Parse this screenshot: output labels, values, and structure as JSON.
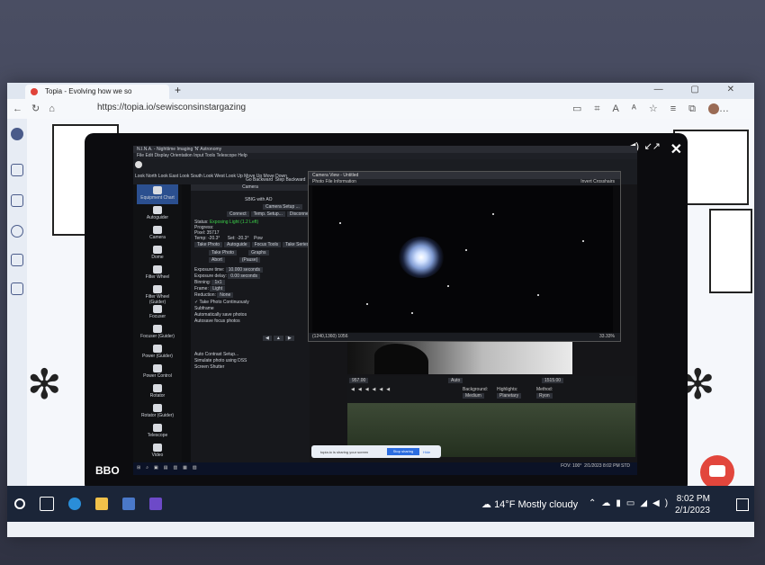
{
  "browser": {
    "tab_title": "Topia - Evolving how we so",
    "new_tab": "+",
    "window_controls": "— ▢ ✕",
    "url": "https://topia.io/sewisconsinstargazing"
  },
  "overlay": {
    "brand": "BBO"
  },
  "app": {
    "title": "N.I.N.A. - Nighttime Imaging 'N' Astronomy",
    "menu": "File  Edit  Display  Orientation  Input  Tools  Telescope  Help",
    "toolbar": [
      "Look North",
      "Look East",
      "Look South",
      "Look West",
      "Look Up",
      "Move Up",
      "Move Down"
    ],
    "toolbar2": [
      "Go Backward",
      "Step Backward"
    ],
    "sidebar": [
      "Equipment Chart",
      "Autoguider",
      "Camera",
      "Dome",
      "Filter Wheel",
      "Filter Wheel (Guider)",
      "Focuser",
      "Focuser (Guider)",
      "Power (Guider)",
      "Power Control",
      "Rotator",
      "Rotator (Guider)",
      "Telescope",
      "Video"
    ],
    "camera_panel": {
      "header": "Camera",
      "camera_name": "SBIG with AO",
      "setup_button": "Camera Setup ...",
      "connect": "Connect",
      "temp_setup": "Temp. Setup...",
      "disconnect": "Disconne",
      "status_label": "Status:",
      "status_value": "Exposing Light (1.2 Left)",
      "progress_label": "Progress:",
      "pixel_label": "Pixel:",
      "pixel_value": "35717",
      "temp_label": "Temp:",
      "temp_value": "-20.3°",
      "set_label": "Set:",
      "set_value": "-20.3°",
      "power_label": "Pow",
      "tabs": [
        "Take Photo",
        "Autoguide",
        "Focus Tools",
        "Take Series"
      ],
      "take_photo": "Take Photo",
      "graphs": "Graphs",
      "abort": "Abort",
      "pause": "(Pause)",
      "exposure_time_label": "Exposure time:",
      "exposure_time_value": "10.000 seconds",
      "exposure_delay_label": "Exposure delay:",
      "exposure_delay_value": "0.00 seconds",
      "binning_label": "Binning:",
      "binning_value": "1x1",
      "frame_label": "Frame:",
      "frame_value": "Light",
      "reduction_label": "Reduction:",
      "reduction_value": "None",
      "take_continuously": "✓ Take Photo Continuously",
      "subframe": "Subframe",
      "autosave": "Automatically save photos",
      "autosave_focus": "Autosave focus photos",
      "auto_contrast": "Auto Contrast Setup...",
      "simulate": "Simulate photo using DSS",
      "screen_shutter": "Screen Shutter"
    },
    "image_window": {
      "title": "Camera View - Untitled",
      "toolbar_left": "Photo    File Information",
      "toolbar_right": "Invert    Crosshairs",
      "status_coords": "(1240,1360) 1056",
      "zoom": "33.33%"
    },
    "stretch": {
      "low": "957.00",
      "auto": "Auto",
      "high": "1515.00",
      "background_label": "Background:",
      "background_value": "Medium",
      "highlights_label": "Highlights:",
      "highlights_value": "Planetary",
      "method_label": "Method:",
      "method_value": "Ryon"
    },
    "status_bar": {
      "fov": "FOV: 100°",
      "date": "2/1/2023",
      "time": "8:02 PM STD"
    }
  },
  "share_bar": {
    "message": "topia.io is sharing your screen",
    "stop": "Stop sharing",
    "hide": "Hide"
  },
  "taskbar": {
    "weather": "14°F  Mostly cloudy",
    "time": "8:02 PM",
    "date": "2/1/2023"
  }
}
